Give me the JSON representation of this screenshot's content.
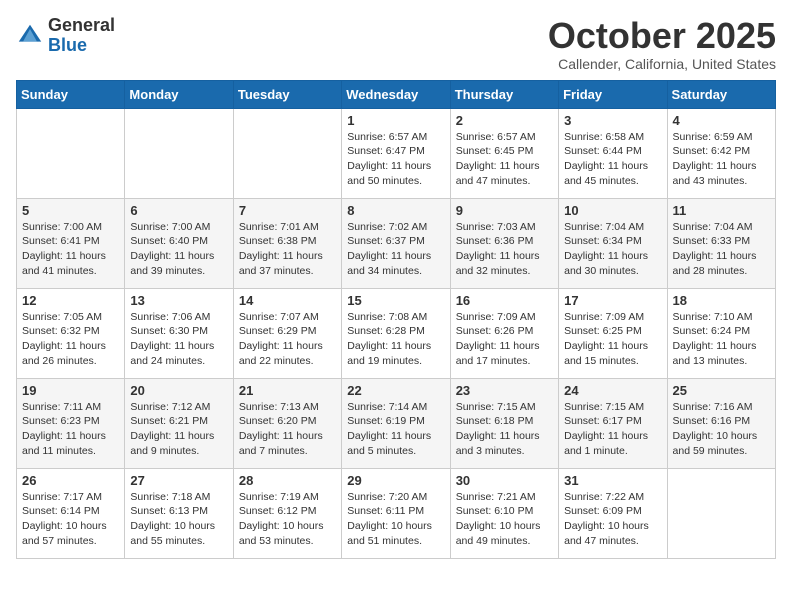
{
  "logo": {
    "general": "General",
    "blue": "Blue"
  },
  "header": {
    "month": "October 2025",
    "location": "Callender, California, United States"
  },
  "days_of_week": [
    "Sunday",
    "Monday",
    "Tuesday",
    "Wednesday",
    "Thursday",
    "Friday",
    "Saturday"
  ],
  "weeks": [
    [
      {
        "day": "",
        "info": ""
      },
      {
        "day": "",
        "info": ""
      },
      {
        "day": "",
        "info": ""
      },
      {
        "day": "1",
        "info": "Sunrise: 6:57 AM\nSunset: 6:47 PM\nDaylight: 11 hours\nand 50 minutes."
      },
      {
        "day": "2",
        "info": "Sunrise: 6:57 AM\nSunset: 6:45 PM\nDaylight: 11 hours\nand 47 minutes."
      },
      {
        "day": "3",
        "info": "Sunrise: 6:58 AM\nSunset: 6:44 PM\nDaylight: 11 hours\nand 45 minutes."
      },
      {
        "day": "4",
        "info": "Sunrise: 6:59 AM\nSunset: 6:42 PM\nDaylight: 11 hours\nand 43 minutes."
      }
    ],
    [
      {
        "day": "5",
        "info": "Sunrise: 7:00 AM\nSunset: 6:41 PM\nDaylight: 11 hours\nand 41 minutes."
      },
      {
        "day": "6",
        "info": "Sunrise: 7:00 AM\nSunset: 6:40 PM\nDaylight: 11 hours\nand 39 minutes."
      },
      {
        "day": "7",
        "info": "Sunrise: 7:01 AM\nSunset: 6:38 PM\nDaylight: 11 hours\nand 37 minutes."
      },
      {
        "day": "8",
        "info": "Sunrise: 7:02 AM\nSunset: 6:37 PM\nDaylight: 11 hours\nand 34 minutes."
      },
      {
        "day": "9",
        "info": "Sunrise: 7:03 AM\nSunset: 6:36 PM\nDaylight: 11 hours\nand 32 minutes."
      },
      {
        "day": "10",
        "info": "Sunrise: 7:04 AM\nSunset: 6:34 PM\nDaylight: 11 hours\nand 30 minutes."
      },
      {
        "day": "11",
        "info": "Sunrise: 7:04 AM\nSunset: 6:33 PM\nDaylight: 11 hours\nand 28 minutes."
      }
    ],
    [
      {
        "day": "12",
        "info": "Sunrise: 7:05 AM\nSunset: 6:32 PM\nDaylight: 11 hours\nand 26 minutes."
      },
      {
        "day": "13",
        "info": "Sunrise: 7:06 AM\nSunset: 6:30 PM\nDaylight: 11 hours\nand 24 minutes."
      },
      {
        "day": "14",
        "info": "Sunrise: 7:07 AM\nSunset: 6:29 PM\nDaylight: 11 hours\nand 22 minutes."
      },
      {
        "day": "15",
        "info": "Sunrise: 7:08 AM\nSunset: 6:28 PM\nDaylight: 11 hours\nand 19 minutes."
      },
      {
        "day": "16",
        "info": "Sunrise: 7:09 AM\nSunset: 6:26 PM\nDaylight: 11 hours\nand 17 minutes."
      },
      {
        "day": "17",
        "info": "Sunrise: 7:09 AM\nSunset: 6:25 PM\nDaylight: 11 hours\nand 15 minutes."
      },
      {
        "day": "18",
        "info": "Sunrise: 7:10 AM\nSunset: 6:24 PM\nDaylight: 11 hours\nand 13 minutes."
      }
    ],
    [
      {
        "day": "19",
        "info": "Sunrise: 7:11 AM\nSunset: 6:23 PM\nDaylight: 11 hours\nand 11 minutes."
      },
      {
        "day": "20",
        "info": "Sunrise: 7:12 AM\nSunset: 6:21 PM\nDaylight: 11 hours\nand 9 minutes."
      },
      {
        "day": "21",
        "info": "Sunrise: 7:13 AM\nSunset: 6:20 PM\nDaylight: 11 hours\nand 7 minutes."
      },
      {
        "day": "22",
        "info": "Sunrise: 7:14 AM\nSunset: 6:19 PM\nDaylight: 11 hours\nand 5 minutes."
      },
      {
        "day": "23",
        "info": "Sunrise: 7:15 AM\nSunset: 6:18 PM\nDaylight: 11 hours\nand 3 minutes."
      },
      {
        "day": "24",
        "info": "Sunrise: 7:15 AM\nSunset: 6:17 PM\nDaylight: 11 hours\nand 1 minute."
      },
      {
        "day": "25",
        "info": "Sunrise: 7:16 AM\nSunset: 6:16 PM\nDaylight: 10 hours\nand 59 minutes."
      }
    ],
    [
      {
        "day": "26",
        "info": "Sunrise: 7:17 AM\nSunset: 6:14 PM\nDaylight: 10 hours\nand 57 minutes."
      },
      {
        "day": "27",
        "info": "Sunrise: 7:18 AM\nSunset: 6:13 PM\nDaylight: 10 hours\nand 55 minutes."
      },
      {
        "day": "28",
        "info": "Sunrise: 7:19 AM\nSunset: 6:12 PM\nDaylight: 10 hours\nand 53 minutes."
      },
      {
        "day": "29",
        "info": "Sunrise: 7:20 AM\nSunset: 6:11 PM\nDaylight: 10 hours\nand 51 minutes."
      },
      {
        "day": "30",
        "info": "Sunrise: 7:21 AM\nSunset: 6:10 PM\nDaylight: 10 hours\nand 49 minutes."
      },
      {
        "day": "31",
        "info": "Sunrise: 7:22 AM\nSunset: 6:09 PM\nDaylight: 10 hours\nand 47 minutes."
      },
      {
        "day": "",
        "info": ""
      }
    ]
  ]
}
